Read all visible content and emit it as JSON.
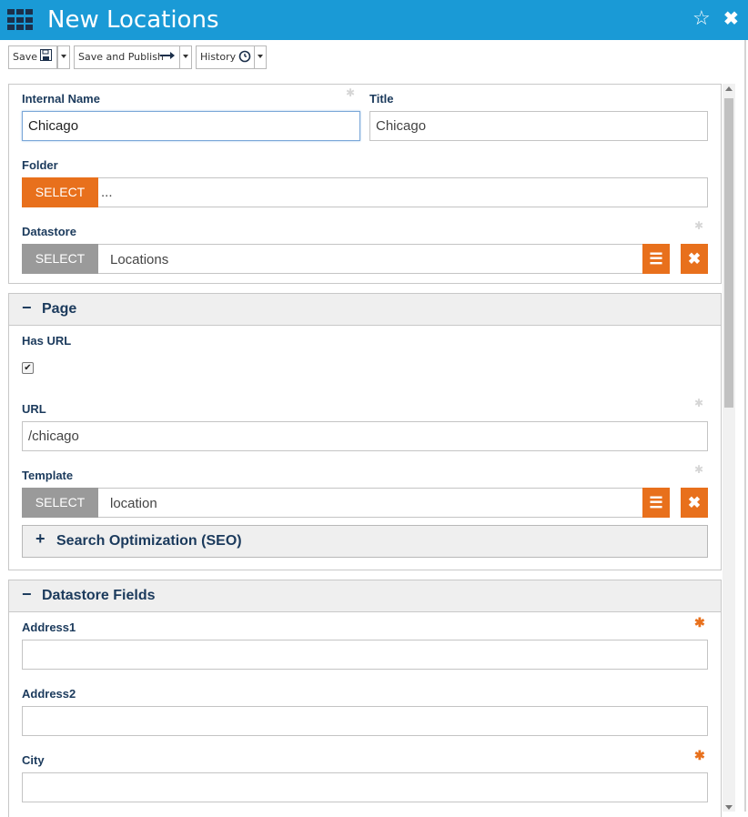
{
  "header": {
    "title": "New Locations"
  },
  "toolbar": {
    "save_label": "Save",
    "save_publish_label": "Save and Publish",
    "history_label": "History"
  },
  "general": {
    "internal_name_label": "Internal Name",
    "internal_name_value": "Chicago",
    "title_label": "Title",
    "title_value": "Chicago",
    "folder_label": "Folder",
    "folder_select_label": "SELECT",
    "folder_value": "...",
    "datastore_label": "Datastore",
    "datastore_select_label": "SELECT",
    "datastore_value": "Locations"
  },
  "page_section": {
    "title": "Page",
    "has_url_label": "Has URL",
    "has_url_checked": true,
    "url_label": "URL",
    "url_value": "/chicago",
    "template_label": "Template",
    "template_select_label": "SELECT",
    "template_value": "location",
    "seo_title": "Search Optimization (SEO)"
  },
  "datastore_fields": {
    "title": "Datastore Fields",
    "address1_label": "Address1",
    "address1_value": "",
    "address2_label": "Address2",
    "address2_value": "",
    "city_label": "City",
    "city_value": ""
  },
  "colors": {
    "header_bg": "#1a9ad6",
    "accent_orange": "#e8701c",
    "label_blue": "#1b3a5c"
  }
}
